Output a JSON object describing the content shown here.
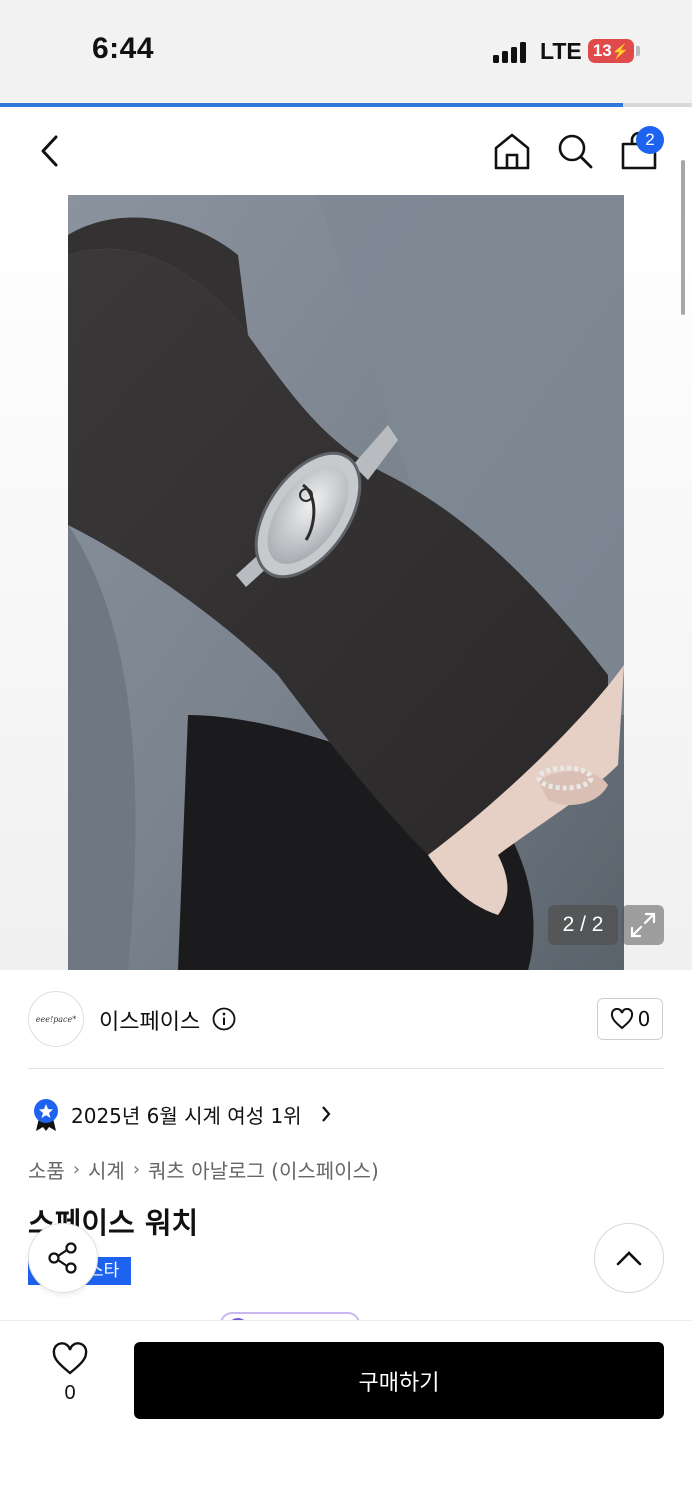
{
  "status_bar": {
    "time": "6:44",
    "network": "LTE",
    "battery": "13",
    "battery_color": "#e14a4a"
  },
  "page_load_progress": 0.9,
  "nav": {
    "back_icon": "chevron-left-icon",
    "home_icon": "home-icon",
    "search_icon": "search-icon",
    "cart_icon": "shopping-bag-icon",
    "cart_count": "2"
  },
  "gallery": {
    "counter": "2 / 2",
    "expand_icon": "expand-icon"
  },
  "brand": {
    "logo_text": "eee!pace*",
    "name": "이스페이스",
    "like_count": "0"
  },
  "ranking": {
    "text": "2025년 6월 시계 여성 1위"
  },
  "breadcrumb": [
    "소품",
    "시계",
    "쿼츠 아날로그 (이스페이스)"
  ],
  "product": {
    "title": "스페이스 워치",
    "tag": "스타"
  },
  "bottom_bar": {
    "wish_count": "0",
    "buy_label": "구매하기"
  },
  "colors": {
    "accent": "#1e63f0",
    "progress": "#2f77d8",
    "buy_button": "#000000"
  }
}
